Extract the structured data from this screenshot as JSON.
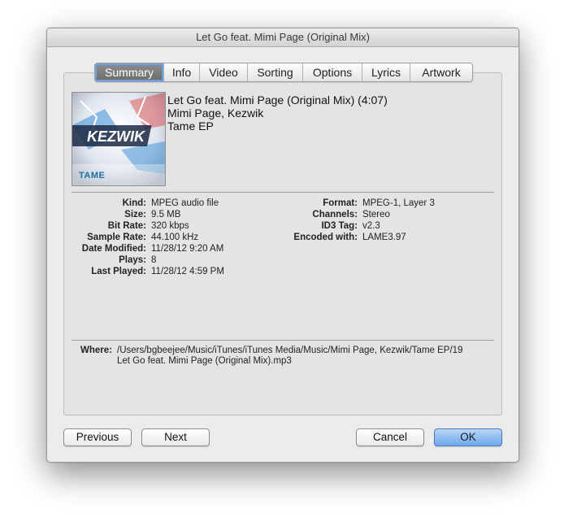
{
  "window": {
    "title": "Let Go feat. Mimi Page (Original Mix)"
  },
  "tabs": [
    {
      "label": "Summary",
      "selected": true
    },
    {
      "label": "Info"
    },
    {
      "label": "Video"
    },
    {
      "label": "Sorting"
    },
    {
      "label": "Options"
    },
    {
      "label": "Lyrics"
    },
    {
      "label": "Artwork"
    }
  ],
  "track": {
    "title_line": "Let Go feat. Mimi Page (Original Mix) (4:07)",
    "artist": "Mimi Page, Kezwik",
    "album": "Tame EP",
    "artwork_text": "TAME"
  },
  "properties_left": [
    {
      "label": "Kind:",
      "value": "MPEG audio file"
    },
    {
      "label": "Size:",
      "value": "9.5 MB"
    },
    {
      "label": "Bit Rate:",
      "value": "320 kbps"
    },
    {
      "label": "Sample Rate:",
      "value": "44.100 kHz"
    },
    {
      "label": "Date Modified:",
      "value": "11/28/12 9:20 AM"
    },
    {
      "label": "Plays:",
      "value": "8"
    },
    {
      "label": "Last Played:",
      "value": "11/28/12 4:59 PM"
    }
  ],
  "properties_right": [
    {
      "label": "Format:",
      "value": "MPEG-1, Layer 3"
    },
    {
      "label": "Channels:",
      "value": "Stereo"
    },
    {
      "label": "ID3 Tag:",
      "value": "v2.3"
    },
    {
      "label": "Encoded with:",
      "value": "LAME3.97"
    }
  ],
  "where": {
    "label": "Where:",
    "line1": "/Users/bgbeejee/Music/iTunes/iTunes Media/Music/Mimi Page, Kezwik/Tame EP/19",
    "line2": "Let Go feat. Mimi Page (Original Mix).mp3"
  },
  "buttons": {
    "previous": "Previous",
    "next": "Next",
    "cancel": "Cancel",
    "ok": "OK"
  },
  "colors": {
    "default_button": "#6ea6ea",
    "selected_tab": "#7a7a7a",
    "window_bg": "#ececec"
  }
}
